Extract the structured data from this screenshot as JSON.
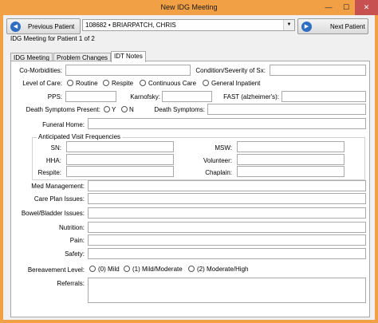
{
  "window": {
    "title": "New IDG Meeting",
    "minimize_glyph": "—",
    "maximize_glyph": "☐",
    "close_glyph": "✕",
    "accent_color": "#f1a046"
  },
  "navigation": {
    "prev_label": "Previous Patient",
    "next_label": "Next Patient",
    "patient_value": "108682 • BRIARPATCH, CHRIS",
    "meeting_label": "IDG Meeting for Patient 1 of 2"
  },
  "tabs": [
    {
      "label": "IDG Meeting",
      "active": false
    },
    {
      "label": "Problem Changes",
      "active": false
    },
    {
      "label": "IDT Notes",
      "active": true
    }
  ],
  "form": {
    "comorbidities_label": "Co-Morbidities:",
    "condition_label": "Condition/Severity of Sx:",
    "level_of_care_label": "Level of Care:",
    "level_of_care_options": [
      "Routine",
      "Respite",
      "Continuous Care",
      "General Inpatient"
    ],
    "pps_label": "PPS:",
    "karnofsky_label": "Karnofsky:",
    "fast_label": "FAST (alzheimer's):",
    "death_symptoms_present_label": "Death Symptoms Present:",
    "death_symptoms_present_options": [
      "Y",
      "N"
    ],
    "death_symptoms_label": "Death Symptoms:",
    "funeral_home_label": "Funeral Home:",
    "visit_frequencies": {
      "title": "Anticipated Visit Frequencies",
      "sn_label": "SN:",
      "msw_label": "MSW:",
      "hha_label": "HHA:",
      "volunteer_label": "Volunteer:",
      "respite_label": "Respite:",
      "chaplain_label": "Chaplain:"
    },
    "med_management_label": "Med Management:",
    "care_plan_label": "Care Plan Issues:",
    "bowel_bladder_label": "Bowel/Bladder Issues:",
    "nutrition_label": "Nutrition:",
    "pain_label": "Pain:",
    "safety_label": "Safety:",
    "bereavement_label": "Bereavement Level:",
    "bereavement_options": [
      "(0) Mild",
      "(1) Mild/Moderate",
      "(2) Moderate/High"
    ],
    "referrals_label": "Referrals:"
  }
}
